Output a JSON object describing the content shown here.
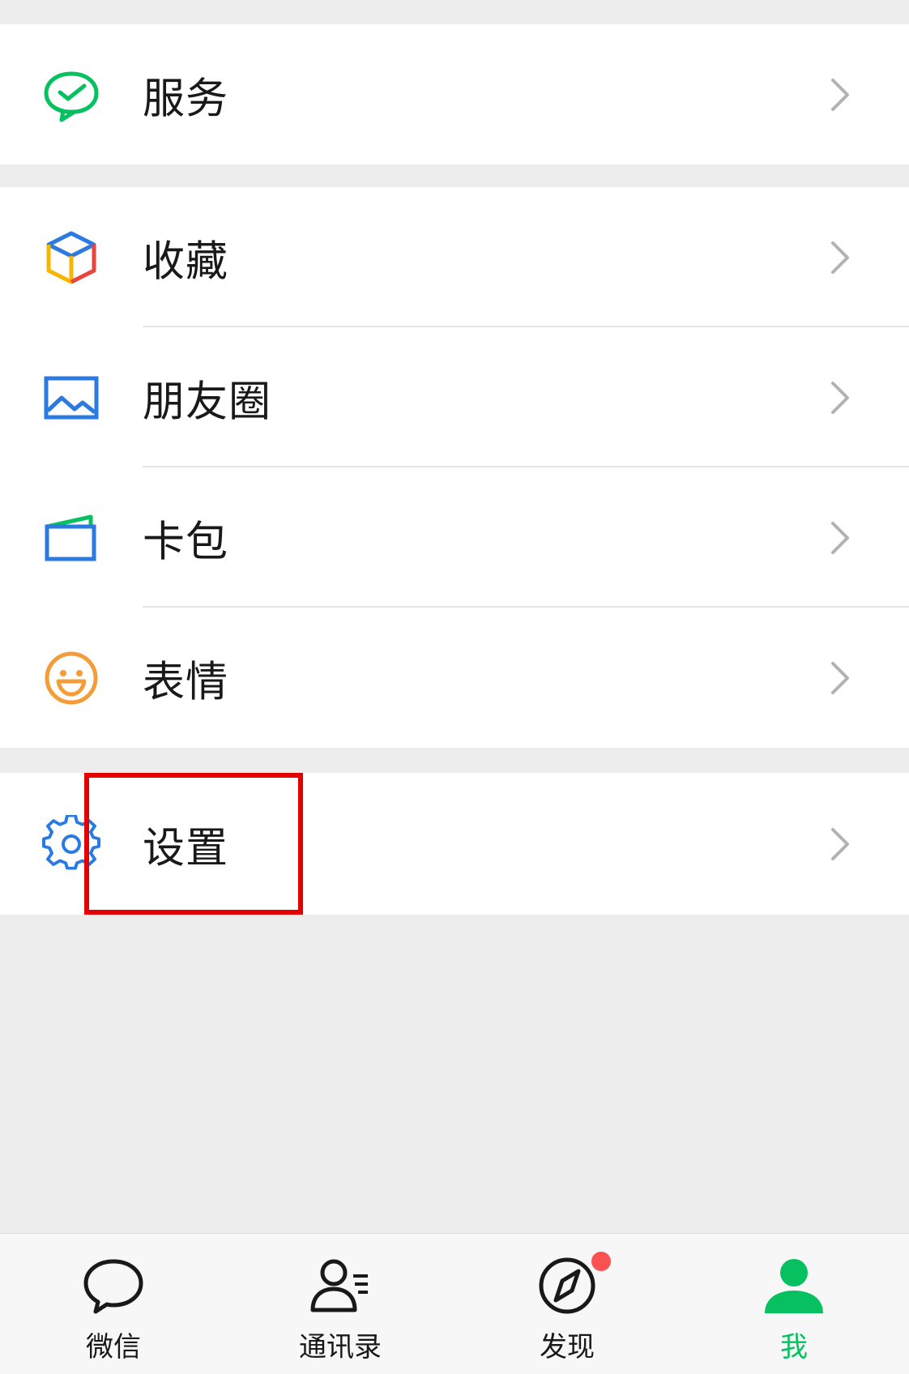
{
  "menu": {
    "services": {
      "label": "服务",
      "icon": "wechat-pay-icon"
    },
    "favorites": {
      "label": "收藏",
      "icon": "favorites-cube-icon"
    },
    "moments": {
      "label": "朋友圈",
      "icon": "image-icon"
    },
    "cards": {
      "label": "卡包",
      "icon": "wallet-icon"
    },
    "stickers": {
      "label": "表情",
      "icon": "smiley-icon"
    },
    "settings": {
      "label": "设置",
      "icon": "gear-icon"
    }
  },
  "tabbar": {
    "chats": {
      "label": "微信",
      "icon": "chat-bubble-icon"
    },
    "contacts": {
      "label": "通讯录",
      "icon": "contacts-icon"
    },
    "discover": {
      "label": "发现",
      "icon": "compass-icon",
      "has_badge": true
    },
    "me": {
      "label": "我",
      "icon": "person-icon",
      "active": true
    }
  },
  "colors": {
    "accent_green": "#07c160",
    "badge_red": "#fa5151",
    "highlight_red": "#e50000",
    "icon_blue": "#2a7ae2",
    "icon_orange": "#f39c38"
  }
}
